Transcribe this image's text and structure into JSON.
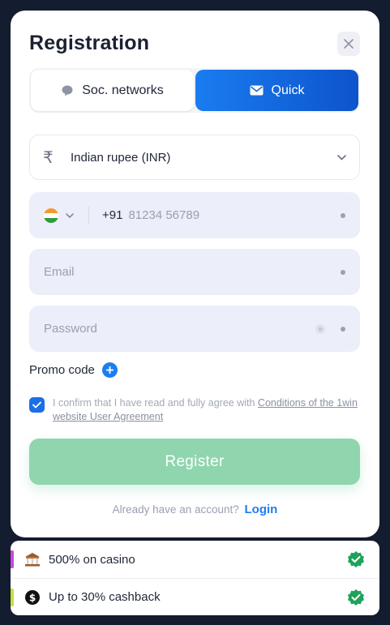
{
  "modal": {
    "title": "Registration",
    "tabs": [
      {
        "label": "Soc. networks",
        "icon": "chat-bubble-icon",
        "active": false
      },
      {
        "label": "Quick",
        "icon": "envelope-icon",
        "active": true
      }
    ],
    "currency": {
      "symbol": "₹",
      "value": "Indian rupee (INR)"
    },
    "phone": {
      "country_code": "+91",
      "placeholder": "81234 56789",
      "flag": "india-flag-icon"
    },
    "email": {
      "placeholder": "Email"
    },
    "password": {
      "placeholder": "Password"
    },
    "promo_label": "Promo code",
    "agreement": {
      "checked": true,
      "text": "I confirm that I have read and fully agree with ",
      "link_text": "Conditions of the 1win website User Agreement"
    },
    "register_label": "Register",
    "login_prompt": "Already have an account?",
    "login_link": "Login"
  },
  "bonuses": [
    {
      "label": "500% on casino",
      "icon": "casino-icon",
      "accent": "#c24fd6"
    },
    {
      "label": "Up to 30% cashback",
      "icon": "cashback-icon",
      "accent": "#c6e03a"
    }
  ],
  "colors": {
    "primary": "#1c7ef0",
    "register_bg": "#8fd6ae",
    "badge_green": "#1fa25a",
    "backdrop": "#141c2f"
  }
}
